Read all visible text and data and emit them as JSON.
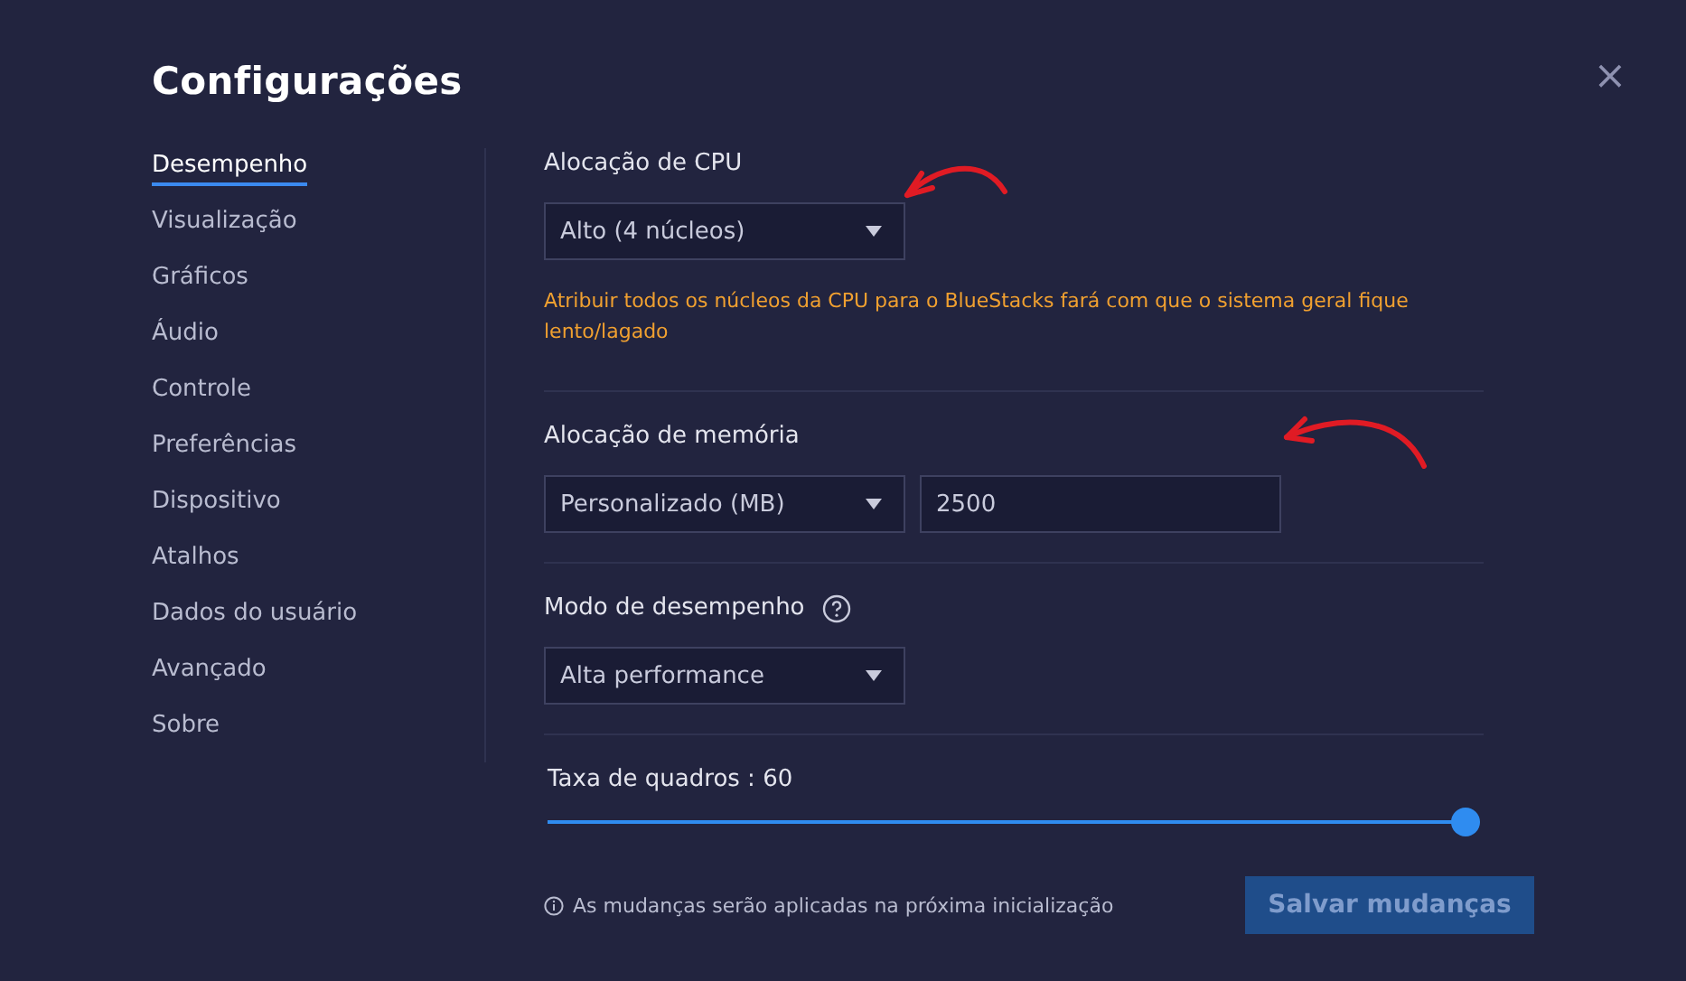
{
  "window": {
    "title": "Configurações",
    "close": "×"
  },
  "sidebar": {
    "items": [
      {
        "label": "Desempenho",
        "selected": true
      },
      {
        "label": "Visualização",
        "selected": false
      },
      {
        "label": "Gráficos",
        "selected": false
      },
      {
        "label": "Áudio",
        "selected": false
      },
      {
        "label": "Controle",
        "selected": false
      },
      {
        "label": "Preferências",
        "selected": false
      },
      {
        "label": "Dispositivo",
        "selected": false
      },
      {
        "label": "Atalhos",
        "selected": false
      },
      {
        "label": "Dados do usuário",
        "selected": false
      },
      {
        "label": "Avançado",
        "selected": false
      },
      {
        "label": "Sobre",
        "selected": false
      }
    ]
  },
  "cpu": {
    "label": "Alocação de CPU",
    "value": "Alto (4 núcleos)",
    "warning": "Atribuir todos os núcleos da CPU para o BlueStacks fará com que o sistema geral fique lento/lagado"
  },
  "memory": {
    "label": "Alocação de memória",
    "value": "Personalizado (MB)",
    "amount": "2500"
  },
  "performance_mode": {
    "label": "Modo de desempenho",
    "value": "Alta performance"
  },
  "frame_rate": {
    "label": "Taxa de quadros : 60",
    "level": 1.0
  },
  "footer": {
    "note": "As mudanças serão aplicadas na próxima inicialização",
    "save": {
      "label": "Salvar mudanças",
      "disabled": true
    }
  },
  "annotations": [
    {
      "kind": "arrow"
    },
    {
      "kind": "arrow"
    }
  ]
}
